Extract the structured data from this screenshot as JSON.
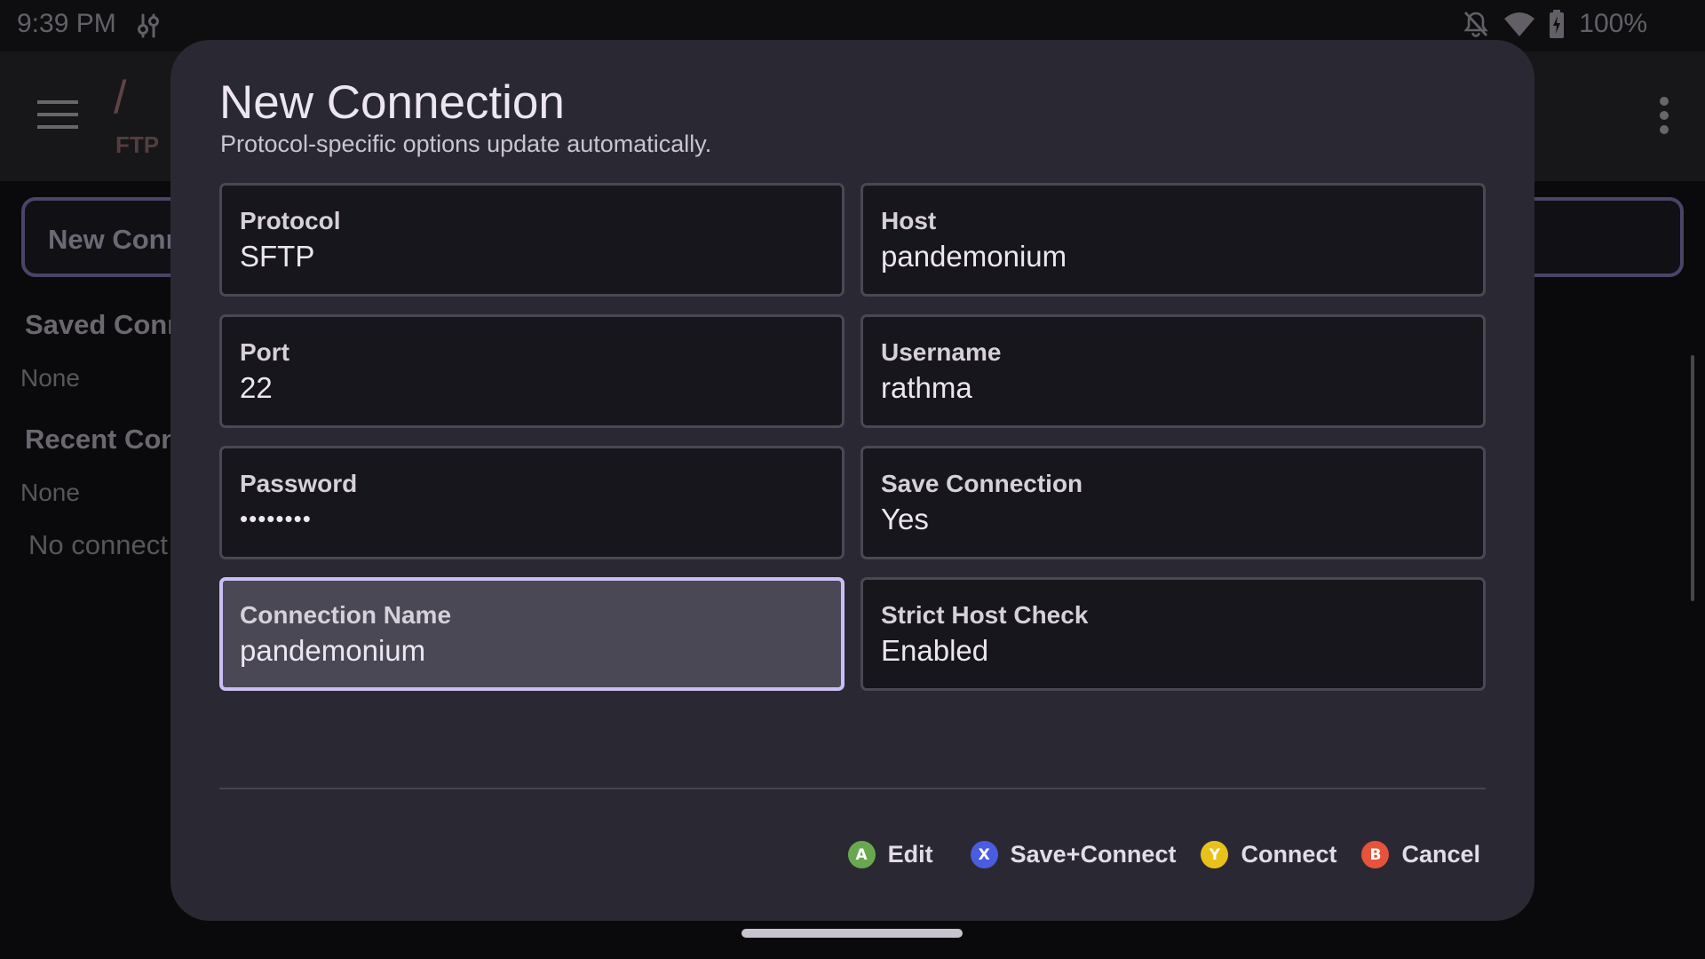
{
  "status_bar": {
    "time": "9:39 PM",
    "battery": "100%",
    "icons": [
      "tune-icon",
      "notifications-off-icon",
      "wifi-icon",
      "battery-charging-icon"
    ]
  },
  "app_bar": {
    "path": "/",
    "subtitle": "FTP ",
    "icons": [
      "menu-icon",
      "more-vert-icon"
    ]
  },
  "background": {
    "new_connection_field": "New Conn",
    "saved_heading": "Saved Conn",
    "saved_value": "None",
    "recent_heading": "Recent Con",
    "recent_value": "None",
    "empty_message": "No connect"
  },
  "dialog": {
    "title": "New Connection",
    "subtitle": "Protocol-specific options update automatically.",
    "fields": [
      {
        "label": "Protocol",
        "value": "SFTP"
      },
      {
        "label": "Host",
        "value": "pandemonium"
      },
      {
        "label": "Port",
        "value": "22"
      },
      {
        "label": "Username",
        "value": "rathma"
      },
      {
        "label": "Password",
        "value": "••••••••"
      },
      {
        "label": "Save Connection",
        "value": "Yes"
      },
      {
        "label": "Connection Name",
        "value": "pandemonium",
        "focused": true
      },
      {
        "label": "Strict Host Check",
        "value": "Enabled"
      }
    ],
    "actions": [
      {
        "button": "A",
        "label": "Edit",
        "color": "#6aa84f"
      },
      {
        "button": "X",
        "label": "Save+Connect",
        "color": "#4a5ce0"
      },
      {
        "button": "Y",
        "label": "Connect",
        "color": "#e8c21a"
      },
      {
        "button": "B",
        "label": "Cancel",
        "color": "#e5533a"
      }
    ]
  },
  "colors": {
    "accent": "#cbbef6",
    "dialog_bg": "#2a2933",
    "field_bg": "#17161c"
  }
}
